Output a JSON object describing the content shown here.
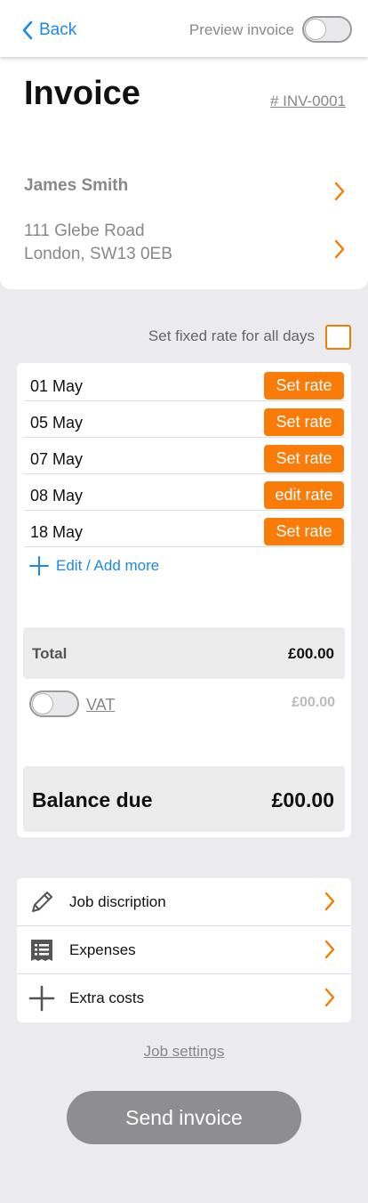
{
  "header": {
    "back_label": "Back",
    "preview_label": "Preview invoice",
    "preview_enabled": false
  },
  "invoice": {
    "title": "Invoice",
    "number": "# INV-0001"
  },
  "client": {
    "name": "James Smith",
    "address_line1": "111 Glebe Road",
    "address_line2": "London, SW13 0EB"
  },
  "fixed_rate": {
    "label": "Set fixed rate for all days",
    "checked": false
  },
  "days": [
    {
      "date": "01 May",
      "action": "Set rate"
    },
    {
      "date": "05 May",
      "action": "Set rate"
    },
    {
      "date": "07 May",
      "action": "Set rate"
    },
    {
      "date": "08 May",
      "action": "edit rate"
    },
    {
      "date": "18 May",
      "action": "Set rate"
    }
  ],
  "add_more_label": "Edit / Add more",
  "totals": {
    "total_label": "Total",
    "total_value": "£00.00",
    "vat_label": "VAT",
    "vat_value": "£00.00",
    "vat_enabled": false,
    "balance_label": "Balance due",
    "balance_value": "£00.00"
  },
  "menu": [
    {
      "label": "Job discription",
      "icon": "pencil-icon"
    },
    {
      "label": "Expenses",
      "icon": "receipt-icon"
    },
    {
      "label": "Extra costs",
      "icon": "plus-icon"
    }
  ],
  "job_settings_label": "Job settings",
  "send_label": "Send invoice",
  "colors": {
    "accent_orange": "#fb7b08",
    "link_blue": "#1e88e5",
    "disabled_grey": "#8e8e90"
  }
}
